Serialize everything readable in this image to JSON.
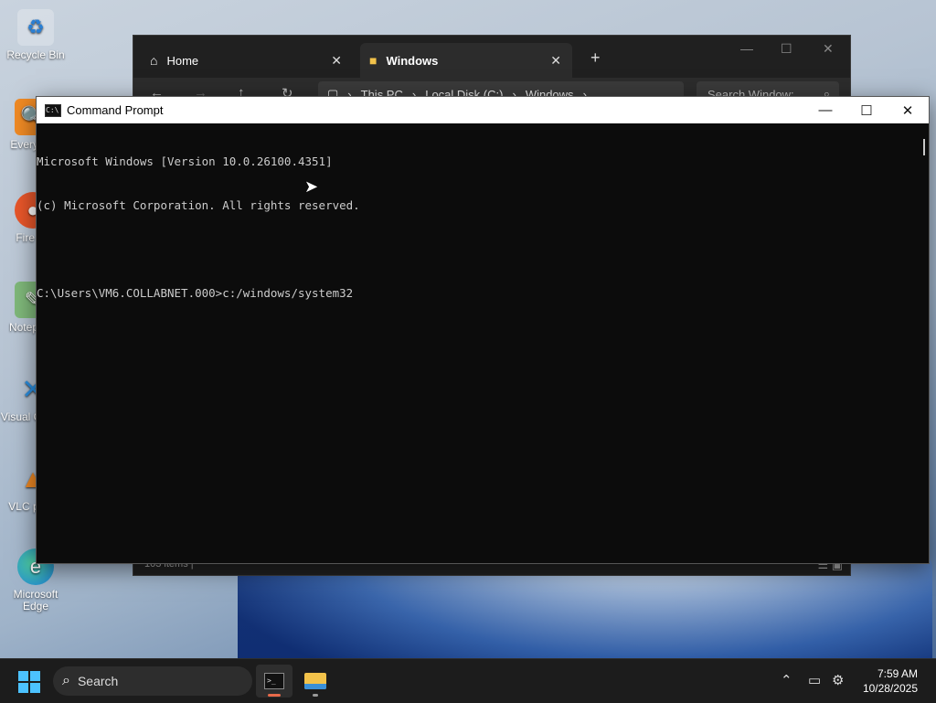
{
  "desktop": {
    "icons": [
      {
        "label": "Recycle Bin",
        "icon": "recycle-bin-icon"
      },
      {
        "label": "Every",
        "icon": "everything-icon"
      },
      {
        "label": "Fire",
        "icon": "firefox-icon"
      },
      {
        "label": "Notep",
        "icon": "notepad-icon"
      },
      {
        "label": "Visual Co",
        "icon": "vscode-icon"
      },
      {
        "label": "VLC pla",
        "icon": "vlc-icon"
      },
      {
        "label": "Microsoft Edge",
        "icon": "edge-icon"
      }
    ]
  },
  "explorer": {
    "tab_home": "Home",
    "tab_windows": "Windows",
    "breadcrumb": [
      "This PC",
      "Local Disk (C:)",
      "Windows"
    ],
    "search_placeholder": "Search Window:",
    "status": "103 items  |"
  },
  "cmd": {
    "title": "Command Prompt",
    "line1": "Microsoft Windows [Version 10.0.26100.4351]",
    "line2": "(c) Microsoft Corporation. All rights reserved.",
    "prompt": "C:\\Users\\VM6.COLLABNET.000>",
    "input": "c:/windows/system32"
  },
  "taskbar": {
    "search_label": "Search",
    "time": "7:59 AM",
    "date": "10/28/2025"
  }
}
